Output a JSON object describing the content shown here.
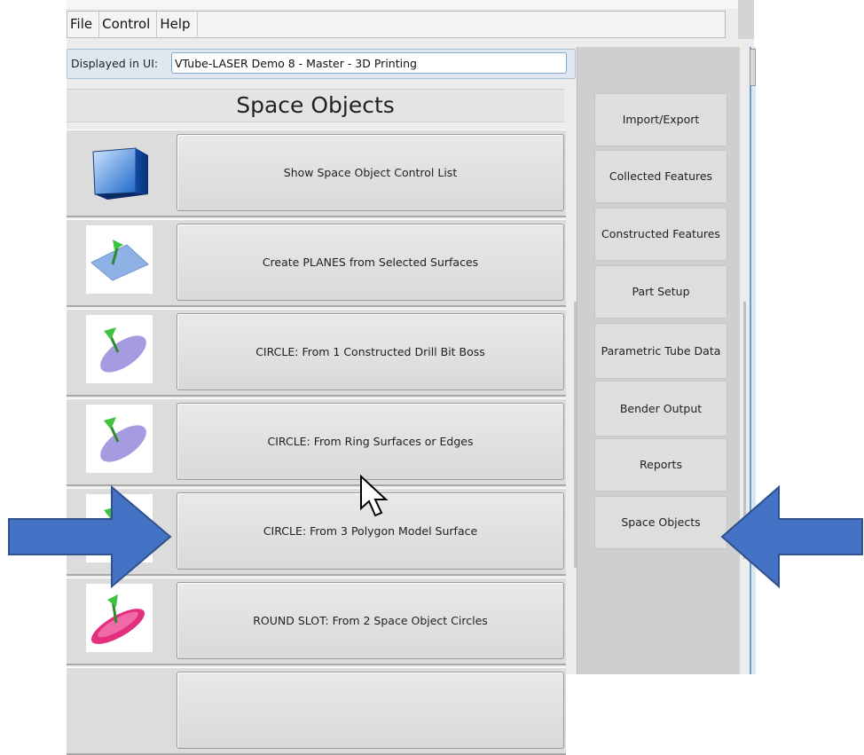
{
  "menu": {
    "items": [
      "File",
      "Control",
      "Help"
    ]
  },
  "displayed": {
    "label": "Displayed in UI:",
    "value": "VTube-LASER Demo 8 - Master - 3D Printing"
  },
  "page_title": "Space Objects",
  "rows": [
    {
      "icon": "blue-cube-icon",
      "label": "Show Space Object Control List"
    },
    {
      "icon": "plane-arrow-icon",
      "label": "Create PLANES from Selected Surfaces"
    },
    {
      "icon": "circle-arrow-icon",
      "label": "CIRCLE: From 1 Constructed Drill Bit Boss"
    },
    {
      "icon": "circle-arrow-icon",
      "label": "CIRCLE: From Ring Surfaces or Edges"
    },
    {
      "icon": "circle-arrow-icon",
      "label": "CIRCLE: From 3 Polygon Model Surface"
    },
    {
      "icon": "round-slot-icon",
      "label": "ROUND SLOT: From 2 Space Object Circles"
    }
  ],
  "sidebar": {
    "items": [
      {
        "label": "Import/Export"
      },
      {
        "label": "Collected Features"
      },
      {
        "label": "Constructed Features"
      },
      {
        "label": "Part Setup"
      },
      {
        "label": "Parametric Tube Data"
      },
      {
        "label": "Bender Output"
      },
      {
        "label": "Reports"
      },
      {
        "label": "Space Objects"
      }
    ]
  },
  "colors": {
    "arrow": "#4472c4",
    "arrow_border": "#2f528f",
    "disp_bg": "#dfe8f1"
  }
}
